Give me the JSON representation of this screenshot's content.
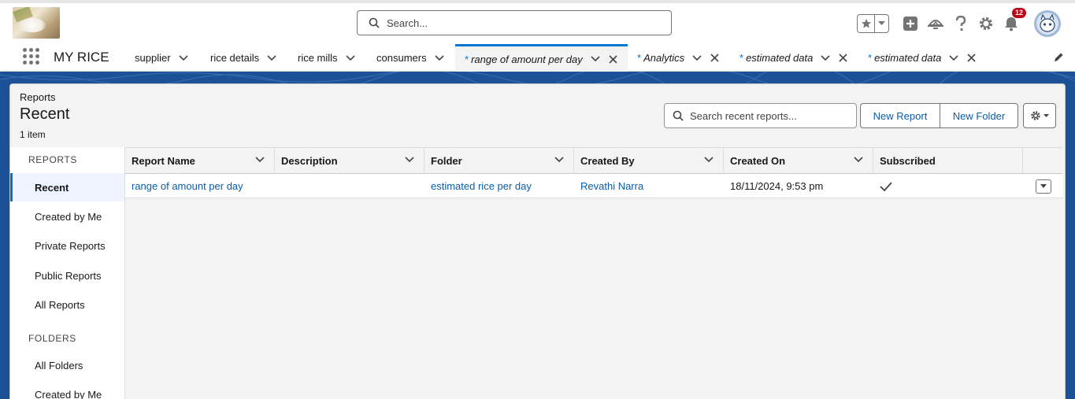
{
  "header": {
    "search_placeholder": "Search...",
    "notification_count": "12",
    "icons": [
      "star-icon",
      "add-icon",
      "trailhead-icon",
      "help-icon",
      "setup-gear-icon",
      "bell-icon",
      "avatar"
    ]
  },
  "nav": {
    "app_name": "MY RICE",
    "items": [
      {
        "label": "supplier"
      },
      {
        "label": "rice details"
      },
      {
        "label": "rice mills"
      },
      {
        "label": "consumers"
      }
    ],
    "tabs": [
      {
        "prefix": "*",
        "label": "range of amount per day",
        "active": true
      },
      {
        "prefix": "*",
        "label": "Analytics"
      },
      {
        "prefix": "*",
        "label": "estimated data"
      },
      {
        "prefix": "*",
        "label": "estimated data"
      }
    ]
  },
  "page": {
    "breadcrumb": "Reports",
    "title": "Recent",
    "count": "1 item",
    "search_placeholder": "Search recent reports...",
    "new_report_label": "New Report",
    "new_folder_label": "New Folder"
  },
  "sidebar": {
    "reports_heading": "REPORTS",
    "report_items": [
      {
        "label": "Recent",
        "active": true
      },
      {
        "label": "Created by Me"
      },
      {
        "label": "Private Reports"
      },
      {
        "label": "Public Reports"
      },
      {
        "label": "All Reports"
      }
    ],
    "folders_heading": "FOLDERS",
    "folder_items": [
      {
        "label": "All Folders"
      },
      {
        "label": "Created by Me"
      }
    ]
  },
  "table": {
    "columns": [
      "Report Name",
      "Description",
      "Folder",
      "Created By",
      "Created On",
      "Subscribed"
    ],
    "rows": [
      {
        "report_name": "range of amount per day",
        "description": "",
        "folder": "estimated rice per day",
        "created_by": "Revathi Narra",
        "created_on": "18/11/2024, 9:53 pm",
        "subscribed": true
      }
    ]
  },
  "colors": {
    "brand_blue": "#0176d3",
    "link_blue": "#0b5cab",
    "banner_blue": "#1b5297",
    "badge_red": "#ba0517"
  }
}
